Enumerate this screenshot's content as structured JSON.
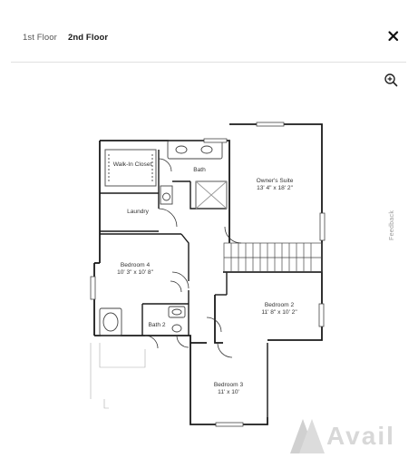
{
  "tabs": [
    {
      "label": "1st Floor",
      "active": false
    },
    {
      "label": "2nd Floor",
      "active": true
    }
  ],
  "icons": {
    "close": "close-icon",
    "zoom": "zoom-in-icon"
  },
  "rooms": {
    "walk_in_closet": {
      "name": "Walk-In Closet"
    },
    "bath": {
      "name": "Bath"
    },
    "owners_suite": {
      "name": "Owner's Suite",
      "size": "13' 4\" x 18' 2\""
    },
    "laundry": {
      "name": "Laundry"
    },
    "bedroom4": {
      "name": "Bedroom 4",
      "size": "10' 3\" x 10' 8\""
    },
    "bedroom2": {
      "name": "Bedroom 2",
      "size": "11' 8\" x 10' 2\""
    },
    "bath2": {
      "name": "Bath 2"
    },
    "bedroom3": {
      "name": "Bedroom 3",
      "size": "11' x 10'"
    }
  },
  "feedback_label": "Feedback",
  "watermark_text": "Avail",
  "colors": {
    "wall": "#1a1a1a",
    "thin_line": "#888888",
    "divider": "#e0e0e0"
  }
}
